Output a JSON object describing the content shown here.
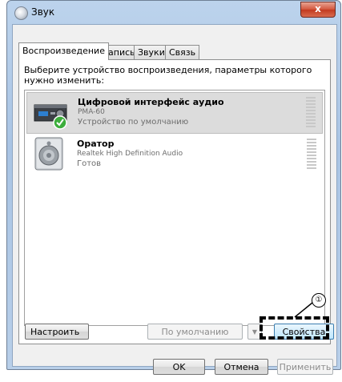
{
  "window": {
    "title": "Звук",
    "close_label": "x"
  },
  "tabs": [
    {
      "label": "Воспроизведение"
    },
    {
      "label": "Запись"
    },
    {
      "label": "Звуки"
    },
    {
      "label": "Связь"
    }
  ],
  "instruction": "Выберите устройство воспроизведения, параметры которого нужно изменить:",
  "devices": [
    {
      "name": "Цифровой интерфейс аудио",
      "model": "PMA-60",
      "status": "Устройство по умолчанию",
      "selected": true,
      "icon": "receiver-icon"
    },
    {
      "name": "Оратор",
      "model": "Realtek High Definition Audio",
      "status": "Готов",
      "selected": false,
      "icon": "speaker-icon"
    }
  ],
  "buttons": {
    "configure": "Настроить",
    "default": "По умолчанию",
    "properties": "Свойства",
    "ok": "OK",
    "cancel": "Отмена",
    "apply": "Применить"
  },
  "callout": {
    "number": "①"
  }
}
